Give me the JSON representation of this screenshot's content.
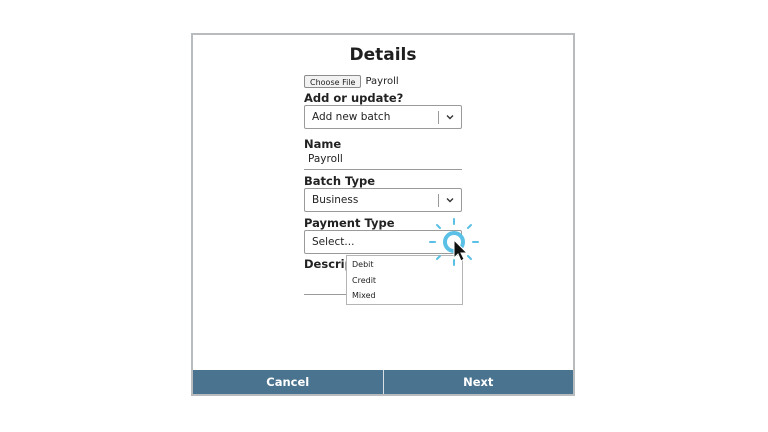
{
  "dialog": {
    "title": "Details",
    "file": {
      "button_label": "Choose File",
      "file_name": "Payroll"
    },
    "add_or_update": {
      "label": "Add or update?",
      "value": "Add new batch"
    },
    "name": {
      "label": "Name",
      "value": "Payroll"
    },
    "batch_type": {
      "label": "Batch Type",
      "value": "Business"
    },
    "payment_type": {
      "label": "Payment Type",
      "value": "Select...",
      "options": [
        "Debit",
        "Credit",
        "Mixed"
      ]
    },
    "description": {
      "label": "Description"
    },
    "footer": {
      "cancel_label": "Cancel",
      "next_label": "Next"
    }
  },
  "colors": {
    "footer_bg": "#4a7390",
    "click_highlight": "#5bc0e6",
    "border": "#b9bcbf"
  },
  "icons": [
    "chevron-down-icon",
    "cursor-pointer-icon",
    "click-highlight-icon"
  ]
}
